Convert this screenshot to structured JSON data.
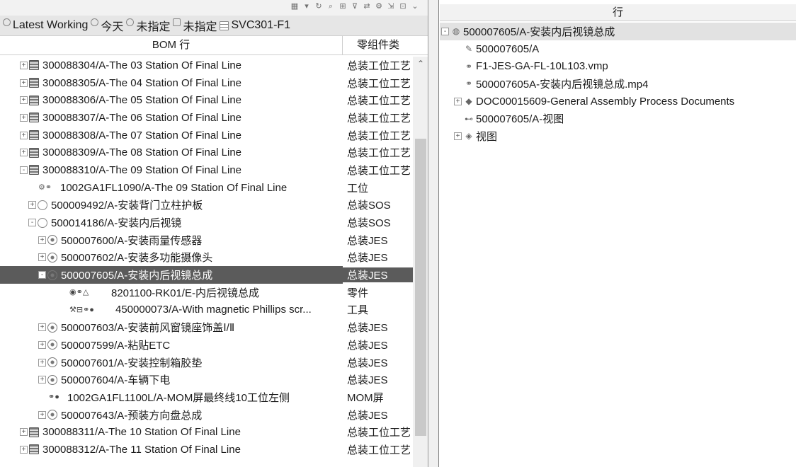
{
  "left_pane": {
    "context_bar": {
      "segments": [
        {
          "icon": "revision-rule-icon",
          "text": "Latest Working"
        },
        {
          "icon": "date-icon",
          "text": "今天"
        },
        {
          "icon": "unit-icon",
          "text": "未指定"
        },
        {
          "icon": "variant-icon",
          "text": "未指定"
        },
        {
          "icon": "form-icon",
          "text": "SVC301-F1"
        }
      ]
    },
    "columns": {
      "bom": "BOM 行",
      "type": "零组件类"
    },
    "rows": [
      {
        "toggle": "+",
        "icon": "station",
        "name": "300088304/A-The 03 Station Of Final Line",
        "type": "总装工位工艺",
        "indent": 0
      },
      {
        "toggle": "+",
        "icon": "station",
        "name": "300088305/A-The 04 Station Of Final Line",
        "type": "总装工位工艺",
        "indent": 0
      },
      {
        "toggle": "+",
        "icon": "station",
        "name": "300088306/A-The 05 Station Of Final Line",
        "type": "总装工位工艺",
        "indent": 0
      },
      {
        "toggle": "+",
        "icon": "station",
        "name": "300088307/A-The 06 Station Of Final Line",
        "type": "总装工位工艺",
        "indent": 0
      },
      {
        "toggle": "+",
        "icon": "station",
        "name": "300088308/A-The 07 Station Of Final Line",
        "type": "总装工位工艺",
        "indent": 0
      },
      {
        "toggle": "+",
        "icon": "station",
        "name": "300088309/A-The 08 Station Of Final Line",
        "type": "总装工位工艺",
        "indent": 0
      },
      {
        "toggle": "-",
        "icon": "station",
        "name": "300088310/A-The 09 Station Of Final Line",
        "type": "总装工位工艺",
        "indent": 0
      },
      {
        "toggle": "",
        "icon": "link",
        "name": "1002GA1FL1090/A-The 09 Station Of Final Line",
        "type": "工位",
        "indent": 1
      },
      {
        "toggle": "+",
        "icon": "sos",
        "name": "500009492/A-安装背门立柱护板",
        "type": "总装SOS",
        "indent": 1
      },
      {
        "toggle": "-",
        "icon": "sos",
        "name": "500014186/A-安装内后视镜",
        "type": "总装SOS",
        "indent": 1
      },
      {
        "toggle": "+",
        "icon": "jes",
        "name": "500007600/A-安装雨量传感器",
        "type": "总装JES",
        "indent": 2
      },
      {
        "toggle": "+",
        "icon": "jes",
        "name": "500007602/A-安装多功能摄像头",
        "type": "总装JES",
        "indent": 2
      },
      {
        "toggle": "-",
        "icon": "jes",
        "name": "500007605/A-安装内后视镜总成",
        "type": "总装JES",
        "indent": 2,
        "selected": true
      },
      {
        "toggle": "",
        "icon": "part",
        "name": "8201100-RK01/E-内后视镜总成",
        "type": "零件",
        "indent": 3
      },
      {
        "toggle": "",
        "icon": "tool",
        "name": "450000073/A-With magnetic Phillips scr...",
        "type": "工具",
        "indent": 3
      },
      {
        "toggle": "+",
        "icon": "jes",
        "name": "500007603/A-安装前风窗镜座饰盖Ⅰ/Ⅱ",
        "type": "总装JES",
        "indent": 2
      },
      {
        "toggle": "+",
        "icon": "jes",
        "name": "500007599/A-粘贴ETC",
        "type": "总装JES",
        "indent": 2
      },
      {
        "toggle": "+",
        "icon": "jes",
        "name": "500007601/A-安装控制箱胶垫",
        "type": "总装JES",
        "indent": 2
      },
      {
        "toggle": "+",
        "icon": "jes",
        "name": "500007604/A-车辆下电",
        "type": "总装JES",
        "indent": 2
      },
      {
        "toggle": "",
        "icon": "mom",
        "name": "1002GA1FL1100L/A-MOM屏最终线10工位左侧",
        "type": "MOM屏",
        "indent": 2
      },
      {
        "toggle": "+",
        "icon": "jes",
        "name": "500007643/A-预装方向盘总成",
        "type": "总装JES",
        "indent": 2
      },
      {
        "toggle": "+",
        "icon": "station",
        "name": "300088311/A-The 10 Station Of Final Line",
        "type": "总装工位工艺",
        "indent": 0
      },
      {
        "toggle": "+",
        "icon": "station",
        "name": "300088312/A-The 11 Station Of Final Line",
        "type": "总装工位工艺",
        "indent": 0
      }
    ]
  },
  "right_pane": {
    "header": "行",
    "rows": [
      {
        "toggle": "-",
        "icon": "jes-icon",
        "glyph": "◍",
        "name": "500007605/A-安装内后视镜总成",
        "indent": 0,
        "root": true
      },
      {
        "toggle": "",
        "icon": "revision-icon",
        "glyph": "✎",
        "name": "500007605/A",
        "indent": 1
      },
      {
        "toggle": "",
        "icon": "dataset-icon",
        "glyph": "⚭",
        "name": "F1-JES-GA-FL-10L103.vmp",
        "indent": 1
      },
      {
        "toggle": "",
        "icon": "dataset-icon",
        "glyph": "⚭",
        "name": "500007605A-安装内后视镜总成.mp4",
        "indent": 1
      },
      {
        "toggle": "+",
        "icon": "document-icon",
        "glyph": "◆",
        "name": "DOC00015609-General Assembly Process Documents",
        "indent": 1
      },
      {
        "toggle": "",
        "icon": "reference-icon",
        "glyph": "⊷",
        "name": "500007605/A-视图",
        "indent": 1
      },
      {
        "toggle": "+",
        "icon": "view-icon",
        "glyph": "◈",
        "name": "视图",
        "indent": 1
      }
    ]
  }
}
